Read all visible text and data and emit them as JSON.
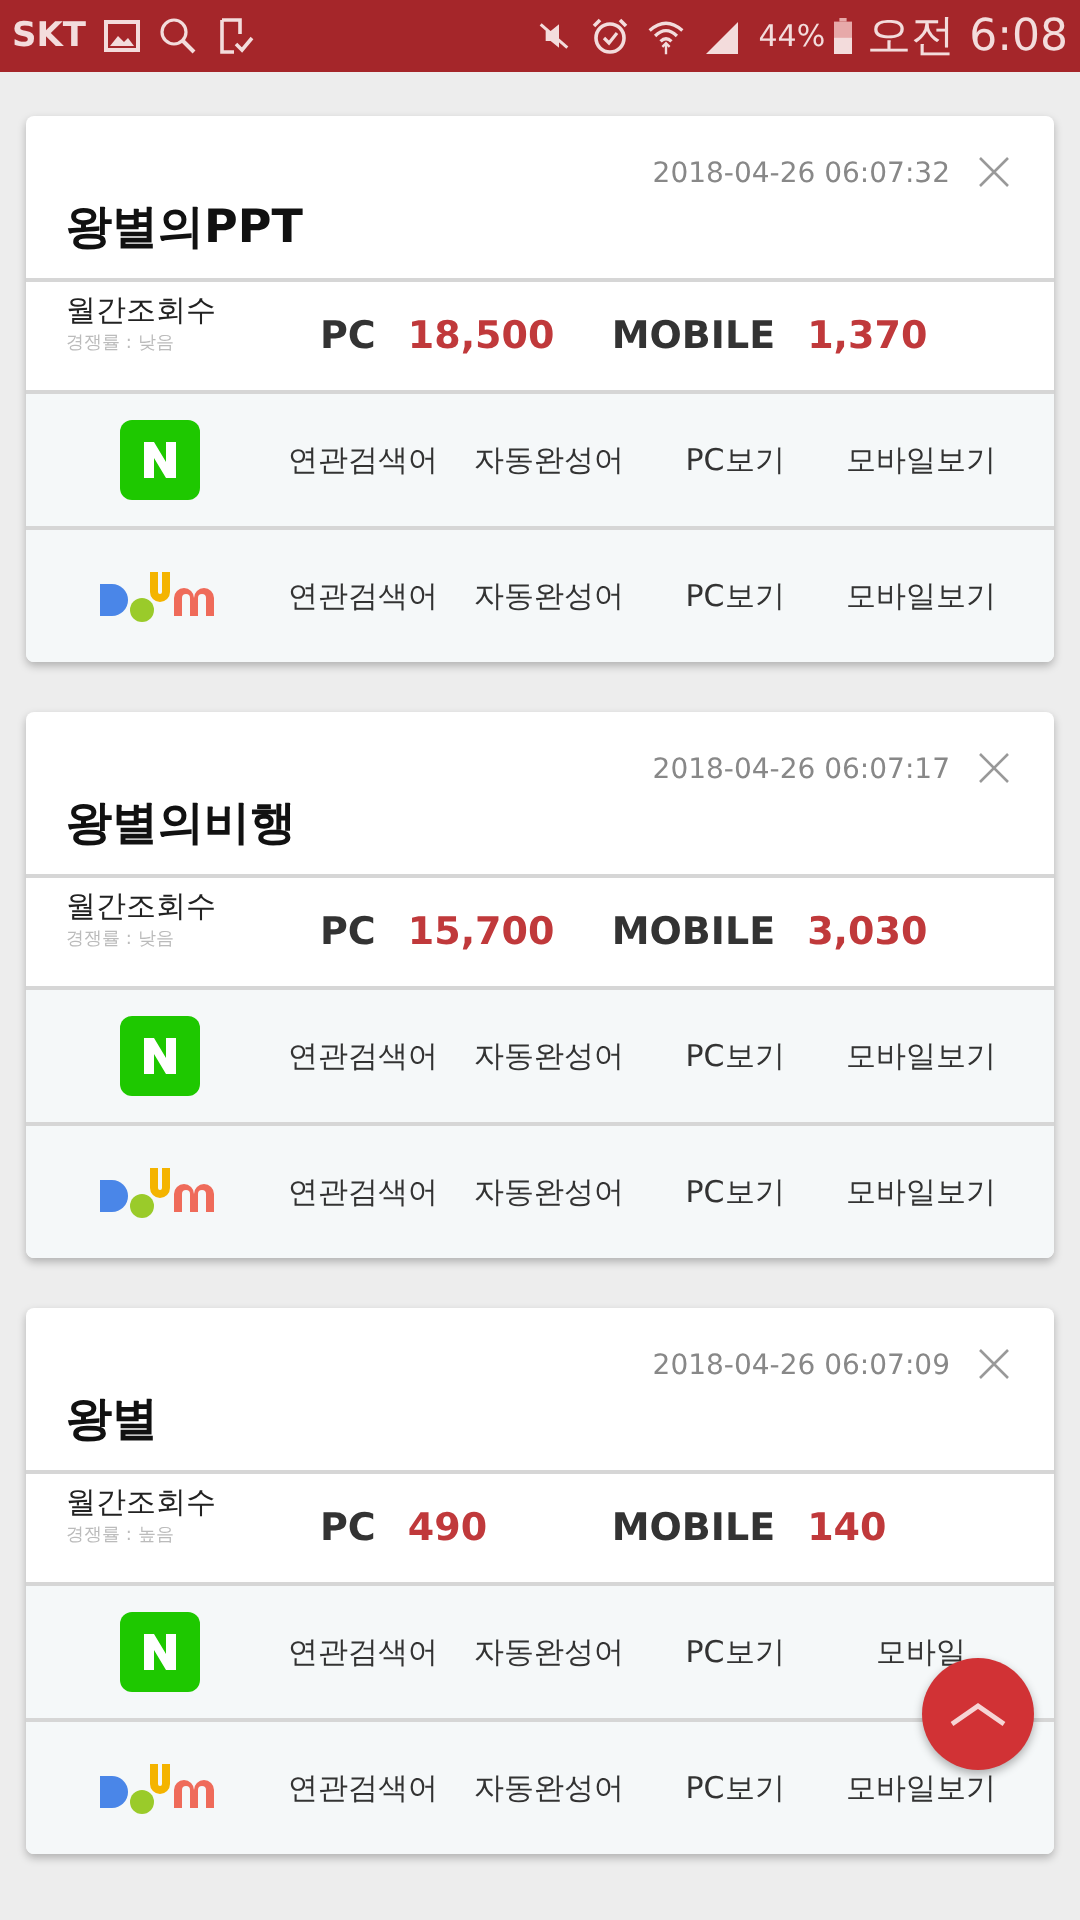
{
  "status_bar": {
    "carrier": "SKT",
    "battery": "44%",
    "time": "오전 6:08"
  },
  "cards": [
    {
      "timestamp": "2018-04-26 06:07:32",
      "title": "왕별의PPT",
      "views_label": "월간조회수",
      "competition": "경쟁률 : 낮음",
      "pc_label": "PC",
      "pc_value": "18,500",
      "mobile_label": "MOBILE",
      "mobile_value": "1,370",
      "engines": [
        {
          "kind": "naver",
          "links": [
            "연관검색어",
            "자동완성어",
            "PC보기",
            "모바일보기"
          ]
        },
        {
          "kind": "daum",
          "links": [
            "연관검색어",
            "자동완성어",
            "PC보기",
            "모바일보기"
          ]
        }
      ]
    },
    {
      "timestamp": "2018-04-26 06:07:17",
      "title": "왕별의비행",
      "views_label": "월간조회수",
      "competition": "경쟁률 : 낮음",
      "pc_label": "PC",
      "pc_value": "15,700",
      "mobile_label": "MOBILE",
      "mobile_value": "3,030",
      "engines": [
        {
          "kind": "naver",
          "links": [
            "연관검색어",
            "자동완성어",
            "PC보기",
            "모바일보기"
          ]
        },
        {
          "kind": "daum",
          "links": [
            "연관검색어",
            "자동완성어",
            "PC보기",
            "모바일보기"
          ]
        }
      ]
    },
    {
      "timestamp": "2018-04-26 06:07:09",
      "title": "왕별",
      "views_label": "월간조회수",
      "competition": "경쟁률 : 높음",
      "pc_label": "PC",
      "pc_value": "490",
      "mobile_label": "MOBILE",
      "mobile_value": "140",
      "engines": [
        {
          "kind": "naver",
          "links": [
            "연관검색어",
            "자동완성어",
            "PC보기",
            "모바일"
          ]
        },
        {
          "kind": "daum",
          "links": [
            "연관검색어",
            "자동완성어",
            "PC보기",
            "모바일보기"
          ]
        }
      ]
    }
  ]
}
